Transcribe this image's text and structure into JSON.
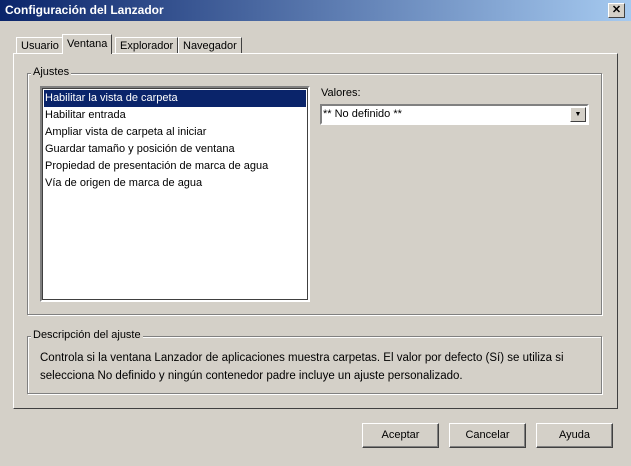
{
  "window": {
    "title": "Configuración del Lanzador",
    "close": "✕"
  },
  "tabs": [
    {
      "label": "Usuario"
    },
    {
      "label": "Ventana"
    },
    {
      "label": "Explorador"
    },
    {
      "label": "Navegador"
    }
  ],
  "settings": {
    "legend": "Ajustes",
    "items": [
      "Habilitar la vista de carpeta",
      "Habilitar entrada",
      "Ampliar vista de carpeta al iniciar",
      "Guardar tamaño y posición de ventana",
      "Propiedad de presentación de marca de agua",
      "Vía de origen de marca de agua"
    ],
    "values_label": "Valores:",
    "value": "** No definido **"
  },
  "description": {
    "legend": "Descripción del ajuste",
    "text": "Controla si la ventana Lanzador de aplicaciones muestra carpetas. El valor por defecto (Sí) se utiliza si selecciona No definido y ningún contenedor padre incluye un ajuste personalizado."
  },
  "buttons": {
    "ok": "Aceptar",
    "cancel": "Cancelar",
    "help": "Ayuda"
  }
}
